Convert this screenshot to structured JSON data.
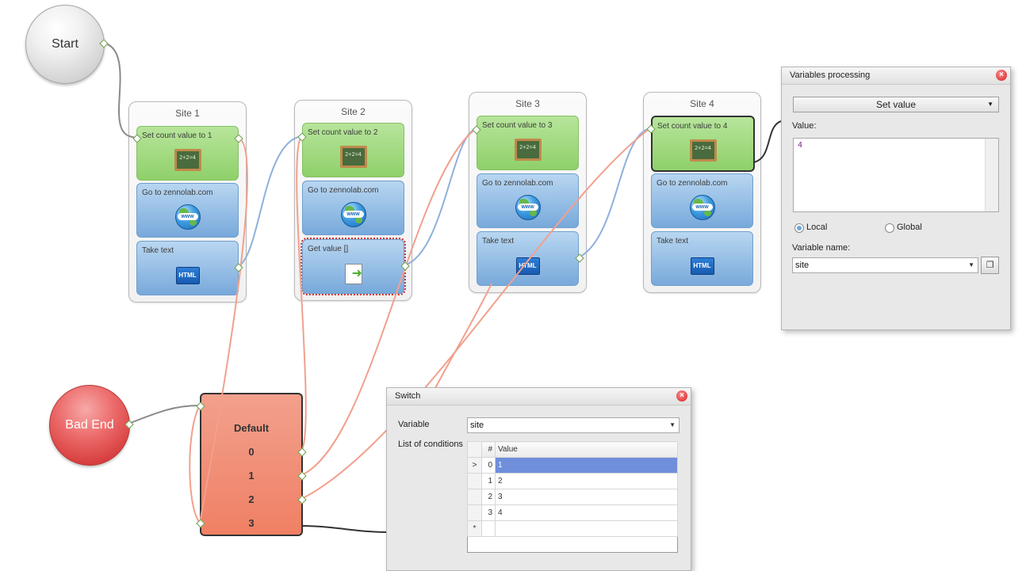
{
  "start": {
    "label": "Start"
  },
  "bad_end": {
    "label": "Bad End"
  },
  "groups": [
    {
      "title": "Site 1",
      "actions": [
        {
          "label": "Set count value to 1",
          "icon": "chalkboard-icon",
          "board_text": "2+2=4"
        },
        {
          "label": "Go to zennolab.com",
          "icon": "globe-www-icon",
          "www": "www"
        },
        {
          "label": "Take text",
          "icon": "html-icon",
          "badge": "HTML"
        }
      ]
    },
    {
      "title": "Site 2",
      "actions": [
        {
          "label": "Set count value to 2",
          "icon": "chalkboard-icon",
          "board_text": "2+2=4"
        },
        {
          "label": "Go to zennolab.com",
          "icon": "globe-www-icon",
          "www": "www"
        },
        {
          "label": "Get value []",
          "icon": "get-value-icon"
        }
      ]
    },
    {
      "title": "Site 3",
      "actions": [
        {
          "label": "Set count value to 3",
          "icon": "chalkboard-icon",
          "board_text": "2+2=4"
        },
        {
          "label": "Go to zennolab.com",
          "icon": "globe-www-icon",
          "www": "www"
        },
        {
          "label": "Take text",
          "icon": "html-icon",
          "badge": "HTML"
        }
      ]
    },
    {
      "title": "Site 4",
      "actions": [
        {
          "label": "Set count value to 4",
          "icon": "chalkboard-icon",
          "board_text": "2+2=4"
        },
        {
          "label": "Go to zennolab.com",
          "icon": "globe-www-icon",
          "www": "www"
        },
        {
          "label": "Take text",
          "icon": "html-icon",
          "badge": "HTML"
        }
      ]
    }
  ],
  "switch_block": {
    "lines": [
      "Default",
      "0",
      "1",
      "2",
      "3"
    ]
  },
  "variables_panel": {
    "title": "Variables processing",
    "action_select": "Set value",
    "value_label": "Value:",
    "value_text": "4",
    "local_label": "Local",
    "global_label": "Global",
    "scope_selected": "Local",
    "variable_name_label": "Variable name:",
    "variable_name_value": "site"
  },
  "switch_panel": {
    "title": "Switch",
    "variable_label": "Variable",
    "variable_value": "site",
    "conditions_label": "List of conditions",
    "table_headers": [
      "#",
      "Value"
    ],
    "rows": [
      {
        "index": "0",
        "value": "1",
        "selected": true
      },
      {
        "index": "1",
        "value": "2",
        "selected": false
      },
      {
        "index": "2",
        "value": "3",
        "selected": false
      },
      {
        "index": "3",
        "value": "4",
        "selected": false
      }
    ],
    "new_row_marker": "*",
    "current_row_marker": ">"
  },
  "colors": {
    "success_wire": "#7fa7d8",
    "fail_wire": "#f2a08d",
    "link_wire": "#888888",
    "selected_outline": "#d32f2f"
  }
}
